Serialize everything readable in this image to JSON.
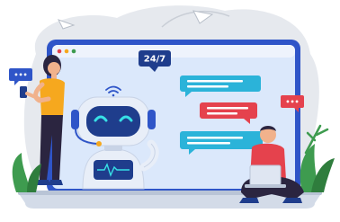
{
  "illustration": {
    "badge_text": "24/7",
    "dots_left": "•••",
    "dots_right": "•••",
    "robot_icon": "robot-icon",
    "wifi_icon": "wifi-icon",
    "palette": {
      "screen_frame": "#2f55c8",
      "screen_bg": "#dbe8fb",
      "bubble_blue": "#2bb3d9",
      "bubble_red": "#e5424d",
      "badge_bg": "#1f3d8c",
      "woman_shirt": "#f6a81e",
      "man_shirt": "#e5424d",
      "robot_body": "#e8eef8",
      "robot_face": "#1f3d8c",
      "robot_eyes": "#37e0e6",
      "plants": "#3e9b4f",
      "blob": "#e6e9ee"
    }
  }
}
